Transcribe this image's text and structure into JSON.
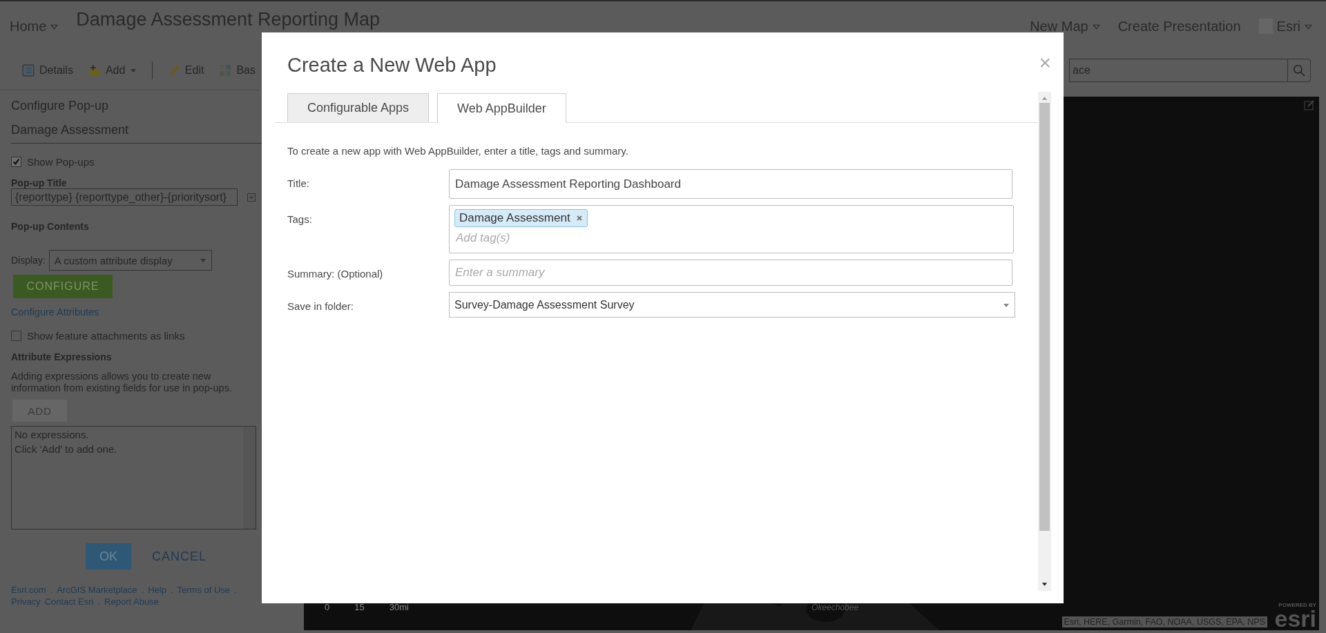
{
  "header": {
    "home": {
      "label": "Home",
      "dropdown": true
    },
    "map_title": "Damage Assessment Reporting Map",
    "menu": [
      {
        "label": "New Map",
        "dropdown": true
      },
      {
        "label": "Create Presentation",
        "dropdown": false
      }
    ],
    "user": {
      "label": "Esri",
      "dropdown": true
    }
  },
  "toolbar": [
    {
      "label": "Details",
      "kind": "details",
      "dropdown": false
    },
    {
      "label": "Add",
      "kind": "add",
      "dropdown": true
    },
    {
      "label": "Edit",
      "kind": "edit",
      "dropdown": false
    },
    {
      "label": "Bas",
      "kind": "basemap",
      "dropdown": false
    }
  ],
  "search": {
    "placeholder": "ace"
  },
  "panel": {
    "title": "Configure Pop-up",
    "layer": "Damage Assessment",
    "show_popups": {
      "label": "Show Pop-ups",
      "checked": true
    },
    "popup_title_label": "Pop-up Title",
    "popup_title_value": "{reporttype} {reporttype_other}-{prioritysort}",
    "contents_label": "Pop-up Contents",
    "display_label": "Display:",
    "display_value": "A custom attribute display",
    "configure_button": "CONFIGURE",
    "configure_link": "Configure Attributes",
    "attachments": {
      "label": "Show feature attachments as links",
      "checked": false
    },
    "expressions_label": "Attribute Expressions",
    "expressions_help": "Adding expressions allows you to create new information from existing fields for use in pop-ups.",
    "add_button": "ADD",
    "expressions_list": [
      "No expressions.",
      "Click 'Add' to add one."
    ],
    "ok": "OK",
    "cancel": "CANCEL",
    "footer_separator": ".",
    "footer_links": [
      "Esri.com",
      "ArcGIS Marketplace",
      "Help",
      "Terms of Use",
      "Privacy",
      "Contact Esri",
      "Report Abuse"
    ]
  },
  "map": {
    "scale_labels": [
      "0",
      "15",
      "30mi"
    ],
    "place_label": "Okeechobee",
    "attribution": "Esri, HERE, Garmin, FAO, NOAA, USGS, EPA, NPS",
    "logo_caption": "POWERED BY",
    "logo": "esri"
  },
  "dialog": {
    "title": "Create a New Web App",
    "close": "×",
    "tabs": [
      {
        "label": "Configurable Apps",
        "selected": false
      },
      {
        "label": "Web AppBuilder",
        "selected": true
      }
    ],
    "intro": "To create a new app with Web AppBuilder, enter a title, tags and summary.",
    "title_label": "Title:",
    "title_value": "Damage Assessment Reporting Dashboard",
    "tags_label": "Tags:",
    "tags": [
      "Damage Assessment"
    ],
    "tags_placeholder": "Add tag(s)",
    "summary_label": "Summary: (Optional)",
    "summary_placeholder": "Enter a summary",
    "folder_label": "Save in folder:",
    "folder_value": "Survey-Damage Assessment Survey"
  }
}
